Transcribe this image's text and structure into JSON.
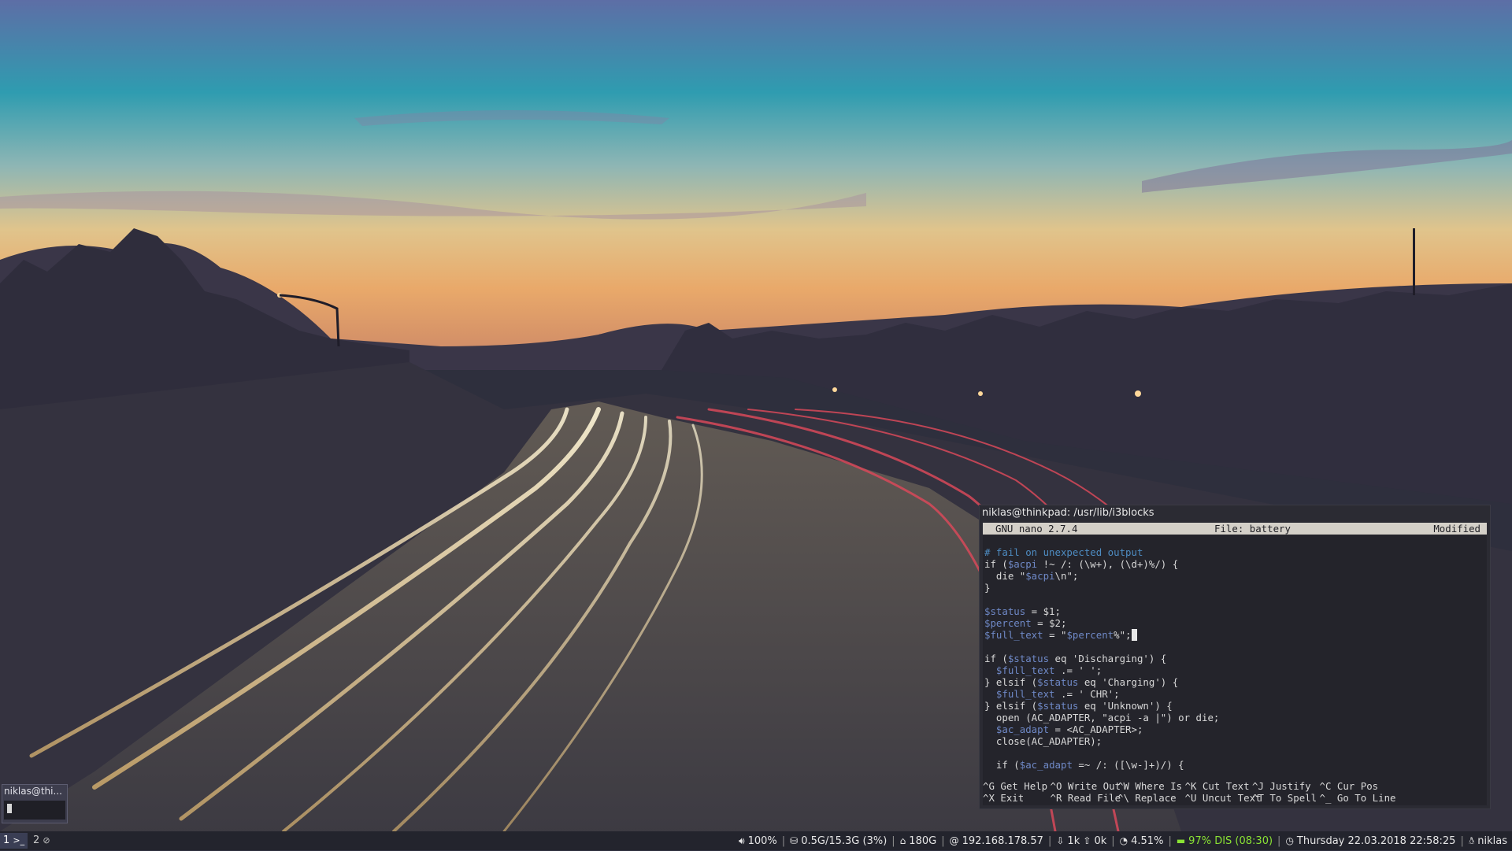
{
  "terminal": {
    "title": "niklas@thinkpad: /usr/lib/i3blocks",
    "nano_version": "GNU nano 2.7.4",
    "file_label": "File: battery",
    "modified": "Modified",
    "code": [
      "# fail on unexpected output",
      "if ($acpi !~ /: (\\w+), (\\d+)%/) {",
      "  die \"$acpi\\n\";",
      "}",
      "",
      "$status = $1;",
      "$percent = $2;",
      "$full_text = \"$percent%\";",
      "",
      "if ($status eq 'Discharging') {",
      "  $full_text .= ' ';",
      "} elsif ($status eq 'Charging') {",
      "  $full_text .= ' CHR';",
      "} elsif ($status eq 'Unknown') {",
      "  open (AC_ADAPTER, \"acpi -a |\") or die;",
      "  $ac_adapt = <AC_ADAPTER>;",
      "  close(AC_ADAPTER);",
      "",
      "  if ($ac_adapt =~ /: ([\\w-]+)/) {"
    ],
    "shortcuts": [
      {
        "key": "^G",
        "label": "Get Help"
      },
      {
        "key": "^O",
        "label": "Write Out"
      },
      {
        "key": "^W",
        "label": "Where Is"
      },
      {
        "key": "^K",
        "label": "Cut Text"
      },
      {
        "key": "^J",
        "label": "Justify"
      },
      {
        "key": "^C",
        "label": "Cur Pos"
      },
      {
        "key": "^X",
        "label": "Exit"
      },
      {
        "key": "^R",
        "label": "Read File"
      },
      {
        "key": "^\\",
        "label": "Replace"
      },
      {
        "key": "^U",
        "label": "Uncut Text"
      },
      {
        "key": "^T",
        "label": "To Spell"
      },
      {
        "key": "^_",
        "label": "Go To Line"
      }
    ]
  },
  "mini_window": {
    "title": "niklas@thi..."
  },
  "bar": {
    "workspaces": [
      {
        "num": "1",
        "icon": "terminal-icon",
        "glyph": ">_"
      },
      {
        "num": "2",
        "icon": "compass-icon",
        "glyph": "⊘"
      }
    ],
    "volume": "100%",
    "memory": "0.5G/15.3G (3%)",
    "disk": "180G",
    "ip": "192.168.178.57",
    "download": "1k",
    "upload": "0k",
    "cpu": "4.51%",
    "battery": "97% DIS (08:30)",
    "datetime": "Thursday 22.03.2018 22:58:25",
    "user": "niklas",
    "colors": {
      "battery": "#8ae234",
      "bar_bg": "#23242d",
      "active_ws": "#3a3e54"
    }
  }
}
